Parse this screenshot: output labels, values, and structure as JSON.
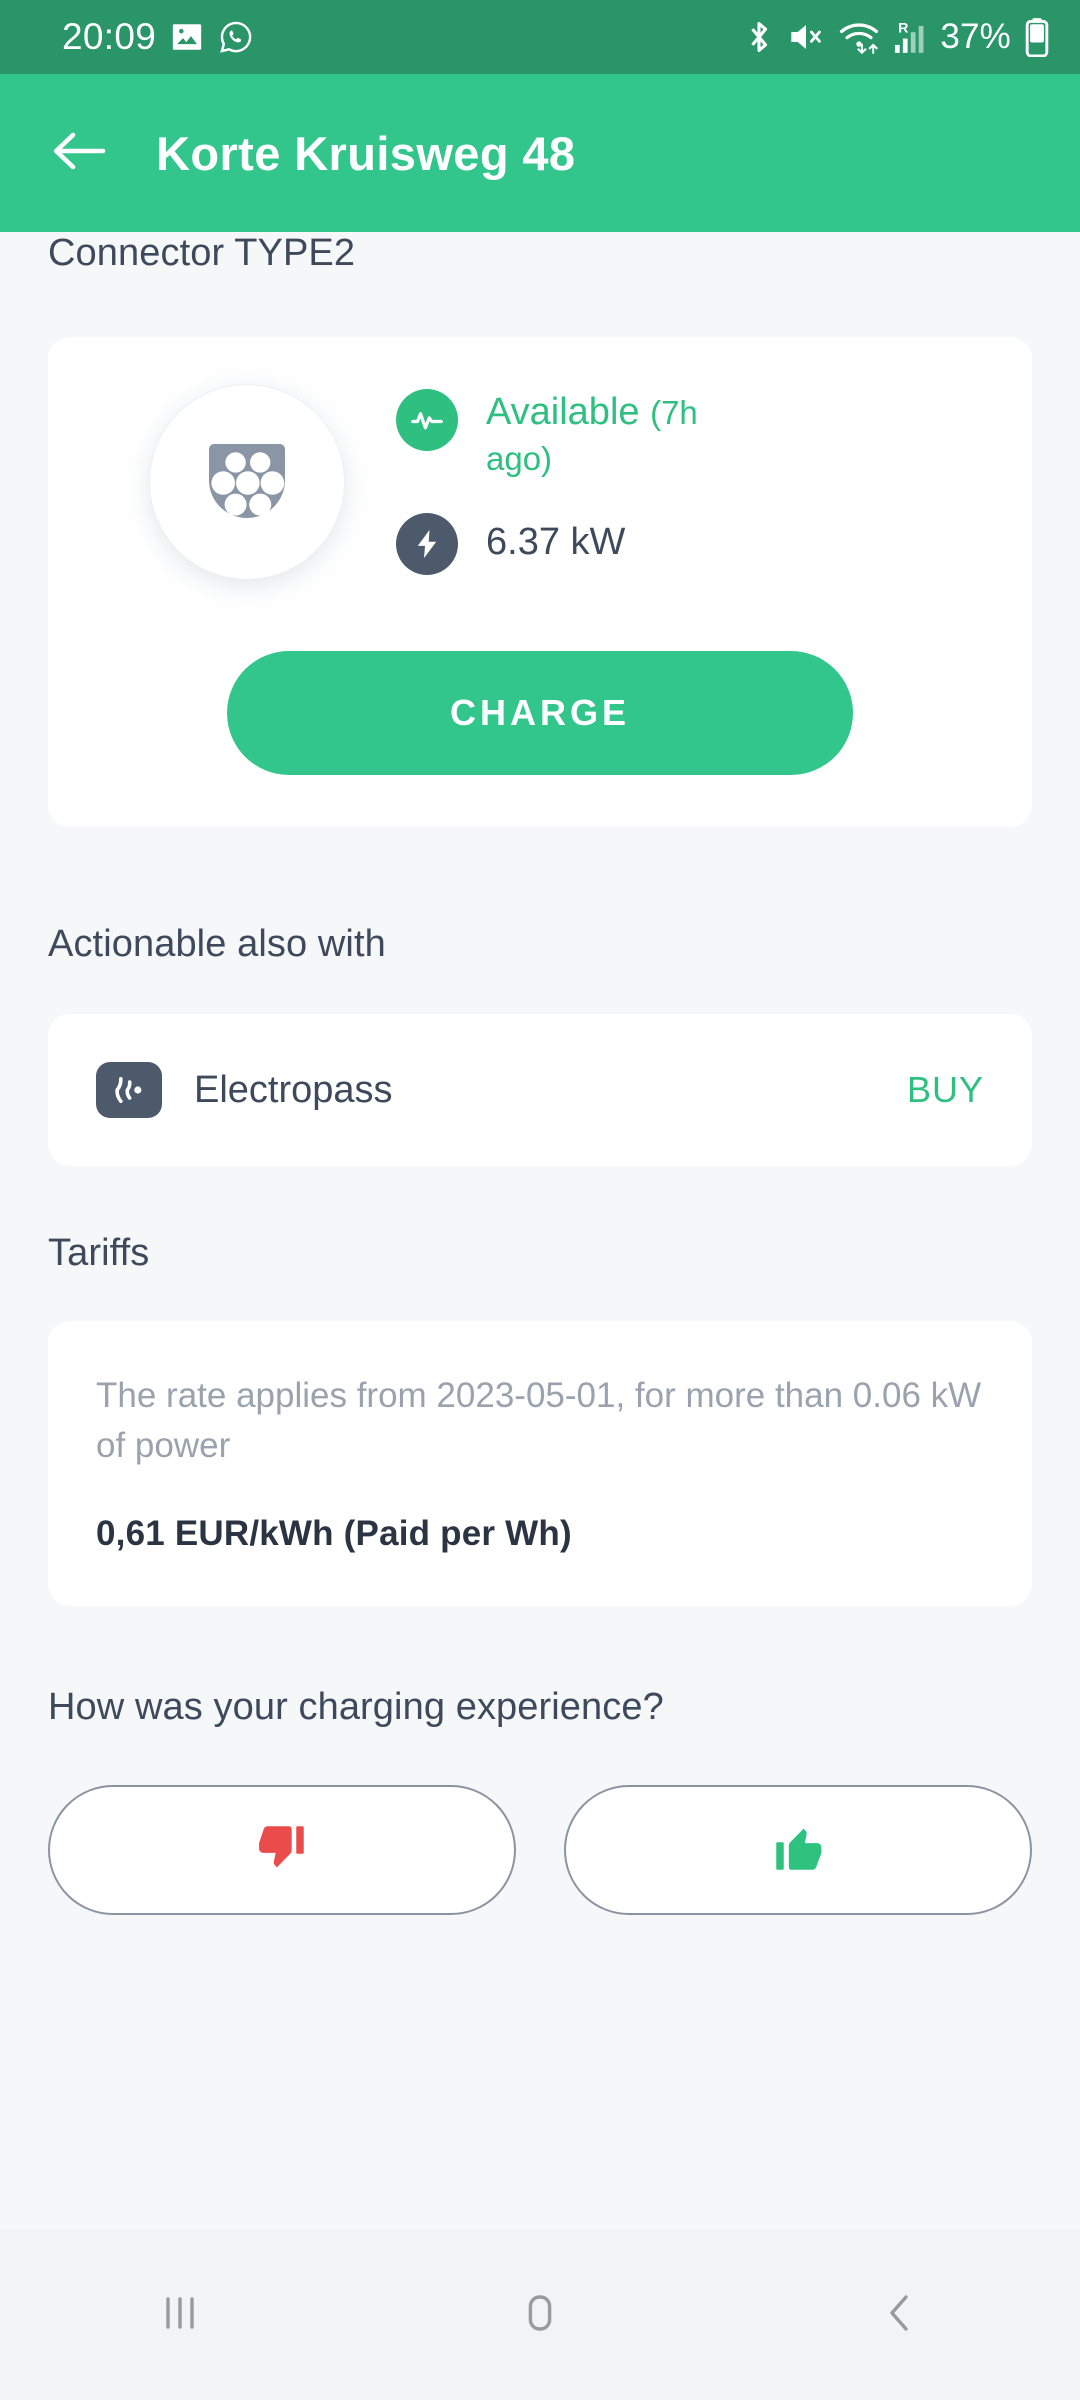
{
  "statusbar": {
    "clock": "20:09",
    "battery_percent": "37%",
    "icons": [
      "gallery-icon",
      "whatsapp-icon",
      "bluetooth-icon",
      "mute-icon",
      "wifi-icon",
      "roaming-signal-icon",
      "battery-icon"
    ]
  },
  "appbar": {
    "back_icon": "arrow-left-icon",
    "title": "Korte Kruisweg 48"
  },
  "connector": {
    "section_title": "Connector TYPE2",
    "icon": "type2-connector-icon",
    "status": "Available",
    "status_age": "(7h ago)",
    "status_icon": "pulse-icon",
    "power": "6.37 kW",
    "power_icon": "lightning-bolt-icon",
    "charge_label": "CHARGE"
  },
  "actionable": {
    "section_title": "Actionable also with",
    "items": [
      {
        "icon": "rfid-contactless-icon",
        "name": "Electropass",
        "action": "BUY"
      }
    ]
  },
  "tariffs": {
    "section_title": "Tariffs",
    "description": "The rate applies from 2023-05-01, for more than 0.06 kW of power",
    "price": "0,61 EUR/kWh (Paid per Wh)"
  },
  "feedback": {
    "question": "How was your charging experience?",
    "negative_icon": "thumbs-down-icon",
    "positive_icon": "thumbs-up-icon"
  },
  "navbar": {
    "recents_icon": "recents-icon",
    "home_icon": "home-icon",
    "back_icon": "back-chevron-icon"
  },
  "colors": {
    "statusbar_green": "#299568",
    "appbar_green": "#33c68c",
    "accent_green": "#2fc081",
    "dark_slate": "#4d5a6b",
    "page_bg": "#f5f7f9",
    "thumbs_down_red": "#ea4c4c",
    "thumbs_up_green": "#2ec27e"
  }
}
